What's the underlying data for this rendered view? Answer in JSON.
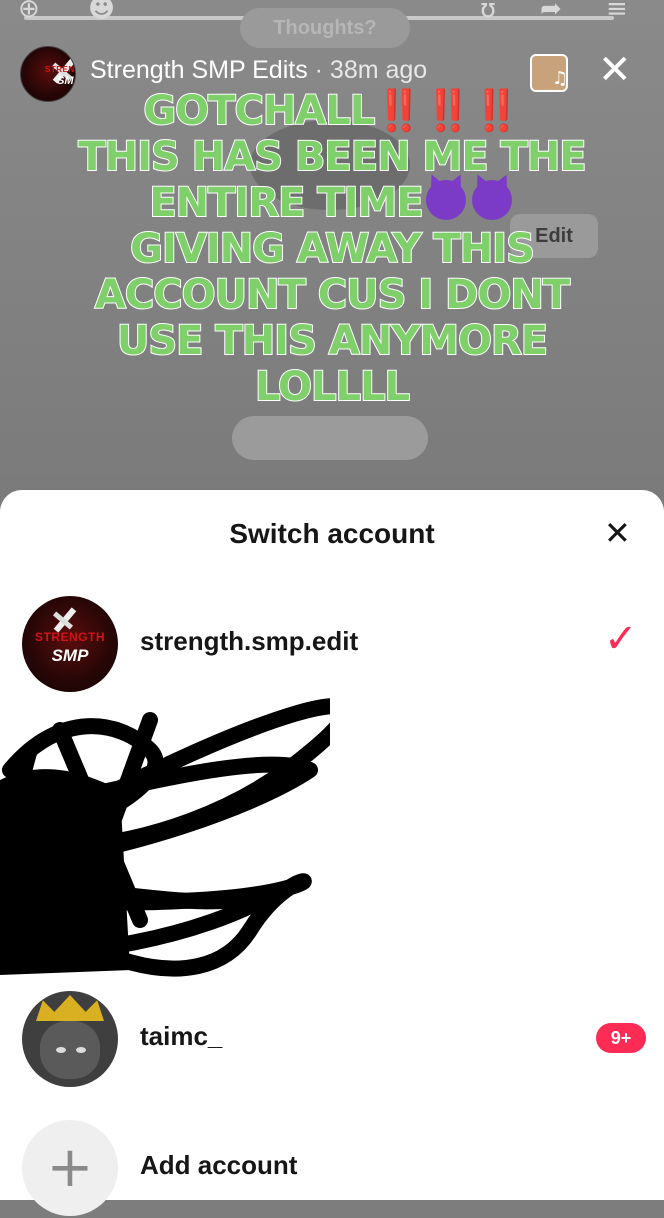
{
  "background": {
    "pill_text": "Thoughts?",
    "edit_label": "Edit"
  },
  "story": {
    "account_name": "Strength SMP Edits",
    "time": " · 38m ago",
    "avatar_text_top": "STRENGTH",
    "avatar_text_bottom": "SMP"
  },
  "caption": {
    "line1": "GOTCHALL",
    "line1_bangs": "‼️‼️‼️",
    "line2": "THIS HAS BEEN ME THE",
    "line3": "ENTIRE TIME",
    "line4": "GIVING AWAY THIS",
    "line5": "ACCOUNT CUS I DONT",
    "line6": "USE THIS ANYMORE",
    "line7": "LOLLLL"
  },
  "sheet": {
    "title": "Switch account",
    "accounts": [
      {
        "name": "strength.smp.edit",
        "avatar_top": "STRENGTH",
        "avatar_bottom": "SMP",
        "selected": true
      },
      {
        "name": "taimc_",
        "badge": "9+"
      }
    ],
    "add_label": "Add account"
  },
  "colors": {
    "accent": "#fe2c55",
    "caption_fill": "#7fcf6a",
    "sheet_bg": "#ffffff"
  },
  "icons": [
    "add-friend-icon",
    "share-icon",
    "menu-icon",
    "music-note-icon",
    "close-icon",
    "checkmark-icon",
    "plus-icon"
  ]
}
